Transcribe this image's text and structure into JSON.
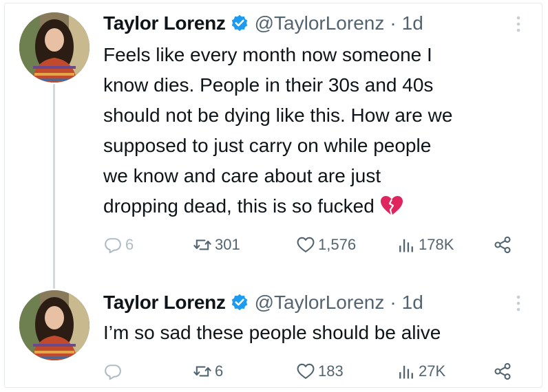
{
  "colors": {
    "text": "#0f1419",
    "secondary": "#536471",
    "verified": "#1d9bf0",
    "broken_heart": "#e0245e",
    "thread_line": "#cfd9de"
  },
  "tweets": [
    {
      "name": "Taylor Lorenz",
      "handle": "@TaylorLorenz",
      "separator": "·",
      "time": "1d",
      "text": "Feels like every month now someone I\nknow dies. People in their 30s and 40s\nshould not be dying like this. How are we\nsupposed to just carry on while people\nwe know and care about are just\ndropping dead, this is so fucked ",
      "emoji": "broken-heart-icon",
      "replies": "6",
      "retweets": "301",
      "likes": "1,576",
      "views": "178K"
    },
    {
      "name": "Taylor Lorenz",
      "handle": "@TaylorLorenz",
      "separator": "·",
      "time": "1d",
      "text": "I’m so sad these people should be alive",
      "replies": "",
      "retweets": "6",
      "likes": "183",
      "views": "27K"
    }
  ]
}
